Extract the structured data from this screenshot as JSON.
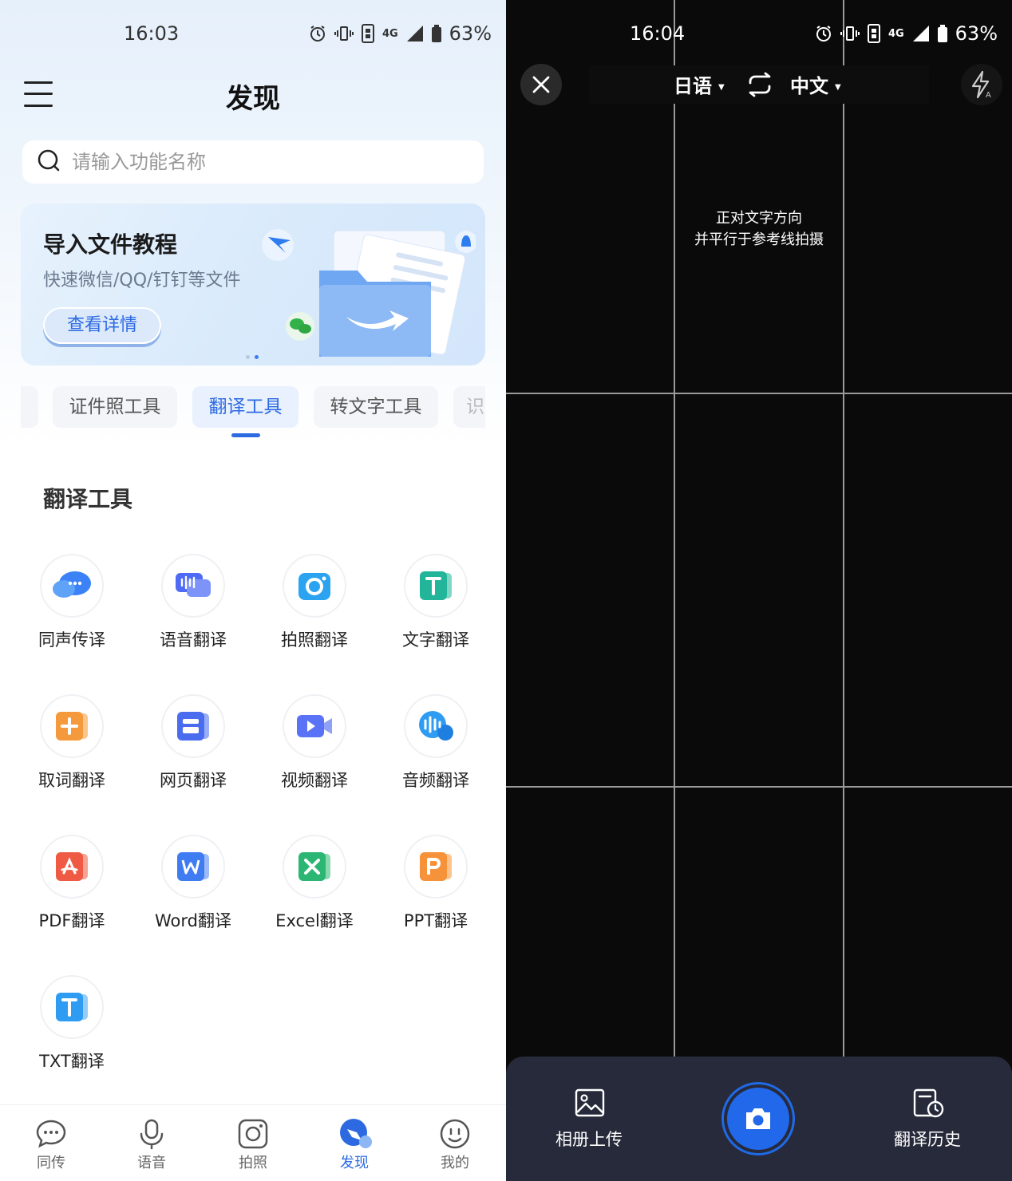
{
  "left": {
    "status": {
      "time": "16:03",
      "battery": "63%",
      "network": "4G"
    },
    "title": "发现",
    "search": {
      "placeholder": "请输入功能名称"
    },
    "banner": {
      "title": "导入文件教程",
      "subtitle": "快速微信/QQ/钉钉等文件",
      "button": "查看详情"
    },
    "tabs": [
      {
        "label": "证件照工具"
      },
      {
        "label": "翻译工具",
        "active": true
      },
      {
        "label": "转文字工具"
      },
      {
        "label": "识"
      }
    ],
    "section_title": "翻译工具",
    "tools": [
      {
        "label": "同声传译",
        "icon": "chat-bubble-icon",
        "color": "#3b82f6"
      },
      {
        "label": "语音翻译",
        "icon": "voice-wave-icon",
        "color": "#4f6bf5"
      },
      {
        "label": "拍照翻译",
        "icon": "camera-icon",
        "color": "#2ba3f0"
      },
      {
        "label": "文字翻译",
        "icon": "text-t-icon",
        "color": "#22b59a"
      },
      {
        "label": "取词翻译",
        "icon": "plus-box-icon",
        "color": "#f59a3c"
      },
      {
        "label": "网页翻译",
        "icon": "webpage-icon",
        "color": "#4a6df0"
      },
      {
        "label": "视频翻译",
        "icon": "video-icon",
        "color": "#5a72f5"
      },
      {
        "label": "音频翻译",
        "icon": "audio-wave-icon",
        "color": "#2e9cf2"
      },
      {
        "label": "PDF翻译",
        "icon": "pdf-icon",
        "color": "#ee5a44"
      },
      {
        "label": "Word翻译",
        "icon": "word-icon",
        "color": "#3f7cf2"
      },
      {
        "label": "Excel翻译",
        "icon": "excel-icon",
        "color": "#2bb673"
      },
      {
        "label": "PPT翻译",
        "icon": "ppt-icon",
        "color": "#f5923a"
      },
      {
        "label": "TXT翻译",
        "icon": "txt-icon",
        "color": "#2e9cf2"
      }
    ],
    "nav": [
      {
        "label": "同传",
        "icon": "chat-icon"
      },
      {
        "label": "语音",
        "icon": "microphone-icon"
      },
      {
        "label": "拍照",
        "icon": "camera-icon"
      },
      {
        "label": "发现",
        "icon": "discover-icon",
        "active": true
      },
      {
        "label": "我的",
        "icon": "smiley-icon"
      }
    ],
    "accent": "#2d6ae2"
  },
  "right": {
    "status": {
      "time": "16:04",
      "battery": "63%",
      "network": "4G"
    },
    "source_lang": "日语",
    "target_lang": "中文",
    "hint_line1": "正对文字方向",
    "hint_line2": "并平行于参考线拍摄",
    "album_label": "相册上传",
    "history_label": "翻译历史"
  }
}
